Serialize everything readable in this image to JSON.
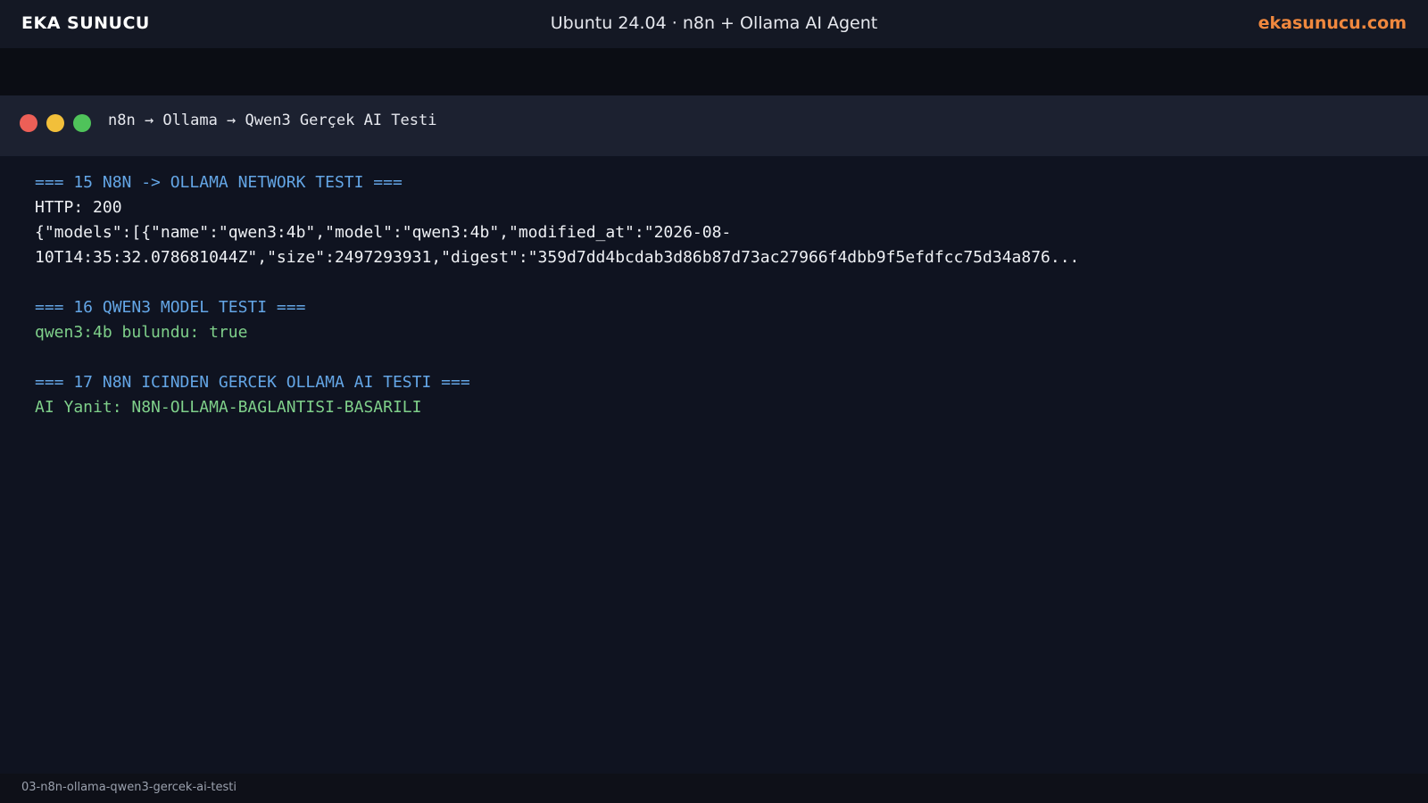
{
  "header": {
    "brand": "EKA SUNUCU",
    "title": "Ubuntu 24.04 · n8n + Ollama AI Agent",
    "site": "ekasunucu.com"
  },
  "window": {
    "title": "n8n → Ollama → Qwen3 Gerçek AI Testi",
    "buttons": [
      "close",
      "minimize",
      "maximize"
    ]
  },
  "terminal": {
    "lines": [
      "=== 15 N8N -> OLLAMA NETWORK TESTI ===",
      "HTTP: 200",
      "{\"models\":[{\"name\":\"qwen3:4b\",\"model\":\"qwen3:4b\",\"modified_at\":\"2026-08-",
      "10T14:35:32.078681044Z\",\"size\":2497293931,\"digest\":\"359d7dd4bcdab3d86b87d73ac27966f4dbb9f5efdfcc75d34a876...",
      "",
      "=== 16 QWEN3 MODEL TESTI ===",
      "qwen3:4b bulundu: true",
      "",
      "=== 17 N8N ICINDEN GERCEK OLLAMA AI TESTI ===",
      "AI Yanit: N8N-OLLAMA-BAGLANTISI-BASARILI"
    ]
  },
  "footer": {
    "caption": "03-n8n-ollama-qwen3-gercek-ai-testi"
  },
  "colors": {
    "accent": "#f0883e",
    "heading": "#64a6e6",
    "success": "#7fd08a",
    "close": "#ec5f57",
    "minimize": "#f2bf3a",
    "maximize": "#4fc35a"
  }
}
